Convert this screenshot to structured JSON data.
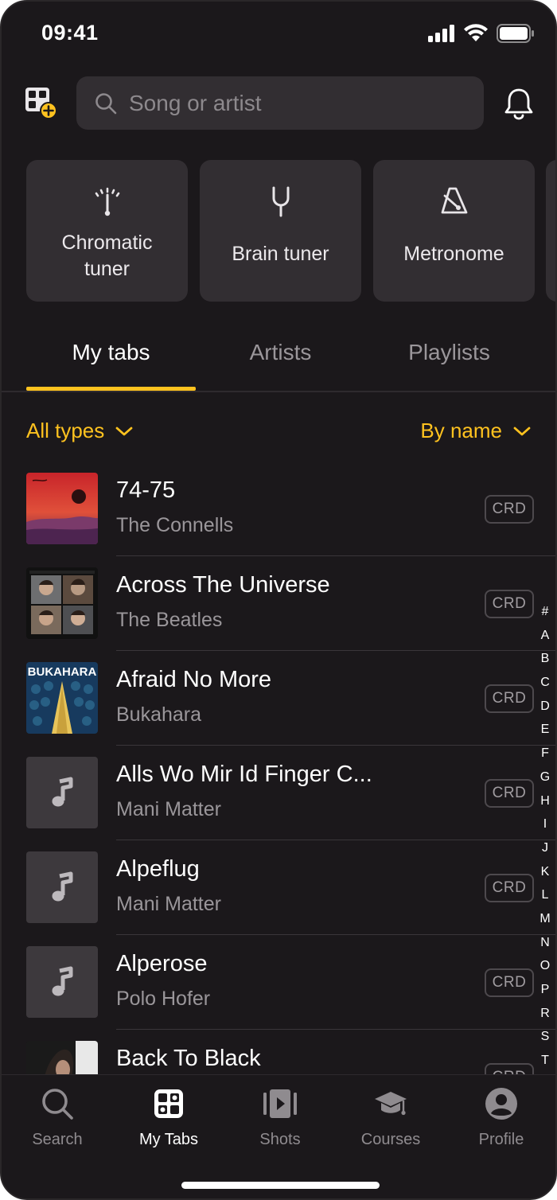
{
  "status_bar": {
    "time": "09:41"
  },
  "search": {
    "placeholder": "Song or artist"
  },
  "tools": [
    {
      "label": "Chromatic tuner",
      "icon": "tuner-icon"
    },
    {
      "label": "Brain tuner",
      "icon": "tuning-fork-icon"
    },
    {
      "label": "Metronome",
      "icon": "metronome-icon"
    }
  ],
  "tabs": [
    {
      "label": "My tabs",
      "active": true
    },
    {
      "label": "Artists",
      "active": false
    },
    {
      "label": "Playlists",
      "active": false
    }
  ],
  "filters": {
    "type": "All types",
    "sort": "By name"
  },
  "songs": [
    {
      "title": "74-75",
      "artist": "The Connells",
      "badge": "CRD",
      "thumb": "album-art-connells"
    },
    {
      "title": "Across The Universe",
      "artist": "The Beatles",
      "badge": "CRD",
      "thumb": "album-art-beatles"
    },
    {
      "title": "Afraid No More",
      "artist": "Bukahara",
      "badge": "CRD",
      "thumb": "album-art-bukahara",
      "art_text": "BUKAHARA"
    },
    {
      "title": "Alls Wo Mir Id Finger C...",
      "artist": "Mani Matter",
      "badge": "CRD",
      "thumb": "music-note-icon"
    },
    {
      "title": "Alpeflug",
      "artist": "Mani Matter",
      "badge": "CRD",
      "thumb": "music-note-icon"
    },
    {
      "title": "Alperose",
      "artist": "Polo Hofer",
      "badge": "CRD",
      "thumb": "music-note-icon"
    },
    {
      "title": "Back To Black",
      "artist": "",
      "badge": "CRD",
      "thumb": "album-art-amy"
    }
  ],
  "alpha_index": [
    "#",
    "A",
    "B",
    "C",
    "D",
    "E",
    "F",
    "G",
    "H",
    "I",
    "J",
    "K",
    "L",
    "M",
    "N",
    "O",
    "P",
    "R",
    "S",
    "T"
  ],
  "bottom_nav": [
    {
      "label": "Search",
      "icon": "search-icon",
      "active": false
    },
    {
      "label": "My Tabs",
      "icon": "my-tabs-icon",
      "active": true
    },
    {
      "label": "Shots",
      "icon": "shots-icon",
      "active": false
    },
    {
      "label": "Courses",
      "icon": "graduation-cap-icon",
      "active": false
    },
    {
      "label": "Profile",
      "icon": "profile-icon",
      "active": false
    }
  ],
  "colors": {
    "accent": "#ffc21f",
    "background": "#1b181b",
    "card": "#322e32"
  }
}
